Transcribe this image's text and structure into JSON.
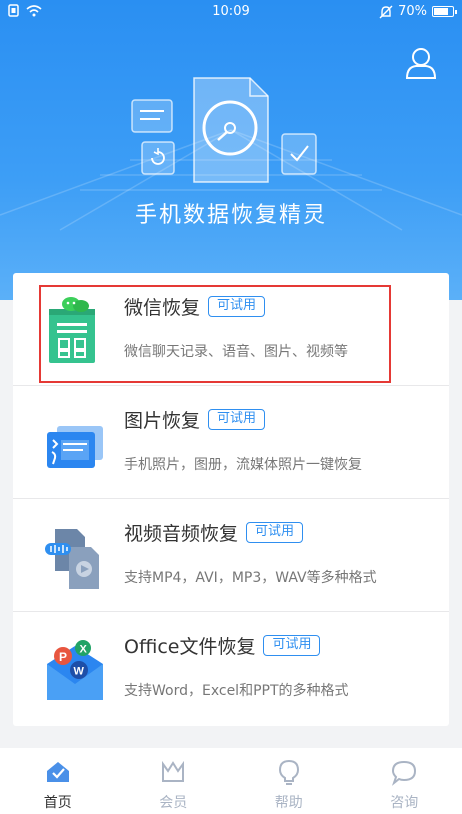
{
  "status_bar": {
    "time": "10:09",
    "battery": "70%"
  },
  "hero": {
    "app_title": "手机数据恢复精灵"
  },
  "items": [
    {
      "name": "微信恢复",
      "badge": "可试用",
      "desc": "微信聊天记录、语音、图片、视频等",
      "icon": "wechat-doc-icon"
    },
    {
      "name": "图片恢复",
      "badge": "可试用",
      "desc": "手机照片，图册，流媒体照片一键恢复",
      "icon": "photo-folder-icon"
    },
    {
      "name": "视频音频恢复",
      "badge": "可试用",
      "desc": "支持MP4，AVI，MP3，WAV等多种格式",
      "icon": "video-audio-icon"
    },
    {
      "name": "Office文件恢复",
      "badge": "可试用",
      "desc": "支持Word，Excel和PPT的多种格式",
      "icon": "office-mail-icon"
    }
  ],
  "tabs": [
    {
      "label": "首页",
      "icon": "home-icon",
      "active": true
    },
    {
      "label": "会员",
      "icon": "crown-icon",
      "active": false
    },
    {
      "label": "帮助",
      "icon": "bulb-icon",
      "active": false
    },
    {
      "label": "咨询",
      "icon": "chat-icon",
      "active": false
    }
  ],
  "colors": {
    "accent": "#2f8ff0",
    "hero": "#2a8ff2",
    "highlight": "#e53935"
  }
}
